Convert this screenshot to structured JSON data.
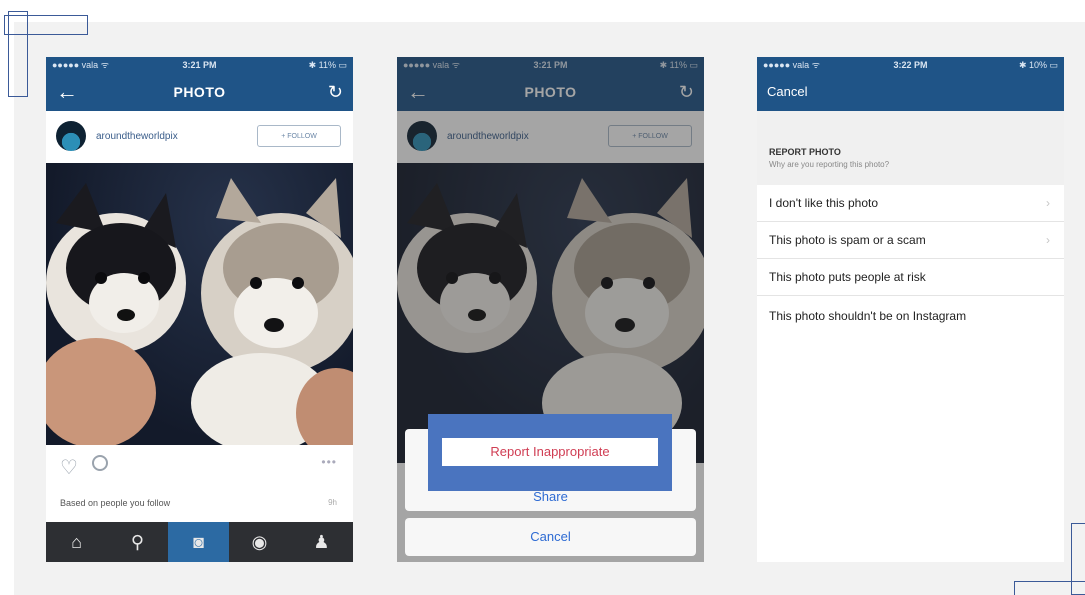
{
  "status_bar": {
    "carrier": "●●●●● vala ᯤ",
    "battery": "✱ 11% ▭"
  },
  "screen1": {
    "time": "3:21 PM",
    "title": "PHOTO",
    "username": "aroundtheworldpix",
    "follow": "+ FOLLOW",
    "caption": "Based on people you follow",
    "caption_time": "9h"
  },
  "screen2": {
    "time": "3:21 PM",
    "title": "PHOTO",
    "username": "aroundtheworldpix",
    "follow": "+ FOLLOW",
    "report": "Report Inappropriate",
    "share": "Share",
    "cancel": "Cancel"
  },
  "screen3": {
    "time": "3:22 PM",
    "battery": "✱ 10% ▭",
    "cancel": "Cancel",
    "heading": "REPORT PHOTO",
    "subheading": "Why are you reporting this photo?",
    "items": [
      "I don't like this photo",
      "This photo is spam or a scam",
      "This photo puts people at risk",
      "This photo shouldn't be on Instagram"
    ]
  },
  "icons": {
    "back": "back-arrow-icon",
    "refresh": "refresh-icon",
    "heart": "heart-icon",
    "comment": "comment-icon",
    "home": "home-icon",
    "search": "search-icon",
    "camera": "camera-icon",
    "news": "news-icon",
    "profile": "profile-icon",
    "chevron": "chevron-right-icon"
  },
  "colors": {
    "nav": "#1f5487",
    "highlight": "#4a74bf",
    "report_text": "#d03d53",
    "action_text": "#2e6bd3"
  }
}
